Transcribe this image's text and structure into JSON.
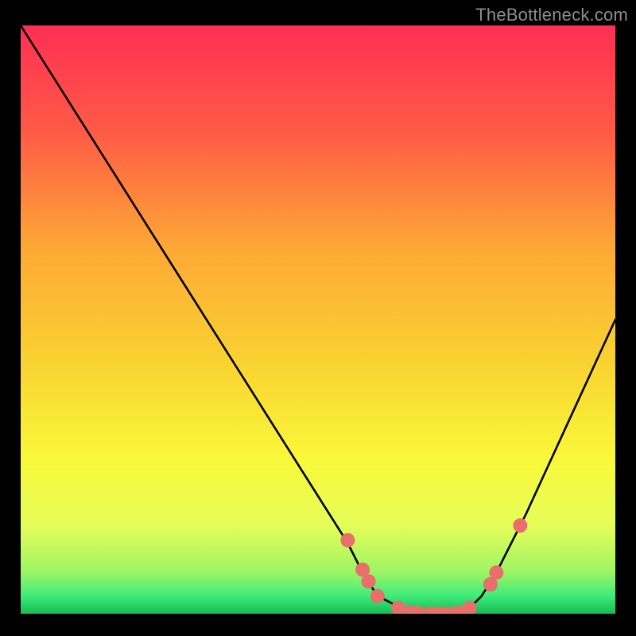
{
  "attribution": "TheBottleneck.com",
  "chart_data": {
    "type": "line",
    "title": "",
    "xlabel": "",
    "ylabel": "",
    "xlim": [
      0,
      1
    ],
    "ylim": [
      0,
      1
    ],
    "grid": false,
    "legend": false,
    "background_gradient_colors": [
      "#FF2F54",
      "#FF7A3A",
      "#F9D431",
      "#F9F93A",
      "#E5FD59",
      "#3DEB7B",
      "#15BC52"
    ],
    "curve": {
      "name": "bottleneck-curve",
      "color": "#000000",
      "x": [
        0.0,
        0.05,
        0.1,
        0.15,
        0.2,
        0.25,
        0.3,
        0.35,
        0.4,
        0.45,
        0.5,
        0.55,
        0.575,
        0.6,
        0.65,
        0.7,
        0.75,
        0.775,
        0.8,
        0.85,
        0.9,
        0.95,
        1.0
      ],
      "y": [
        1.0,
        0.92,
        0.84,
        0.76,
        0.68,
        0.6,
        0.52,
        0.44,
        0.36,
        0.28,
        0.2,
        0.12,
        0.07,
        0.03,
        0.005,
        0.0,
        0.005,
        0.03,
        0.07,
        0.17,
        0.28,
        0.39,
        0.5
      ]
    },
    "markers": {
      "color": "#E86F6B",
      "radius": 9,
      "points": [
        {
          "x": 0.55,
          "y": 0.125
        },
        {
          "x": 0.575,
          "y": 0.075
        },
        {
          "x": 0.585,
          "y": 0.055
        },
        {
          "x": 0.6,
          "y": 0.03
        },
        {
          "x": 0.635,
          "y": 0.01
        },
        {
          "x": 0.655,
          "y": 0.003
        },
        {
          "x": 0.67,
          "y": 0.001
        },
        {
          "x": 0.69,
          "y": 0.0
        },
        {
          "x": 0.7,
          "y": 0.0
        },
        {
          "x": 0.715,
          "y": 0.0
        },
        {
          "x": 0.73,
          "y": 0.001
        },
        {
          "x": 0.745,
          "y": 0.003
        },
        {
          "x": 0.755,
          "y": 0.01
        },
        {
          "x": 0.79,
          "y": 0.05
        },
        {
          "x": 0.8,
          "y": 0.07
        },
        {
          "x": 0.84,
          "y": 0.15
        }
      ]
    }
  }
}
